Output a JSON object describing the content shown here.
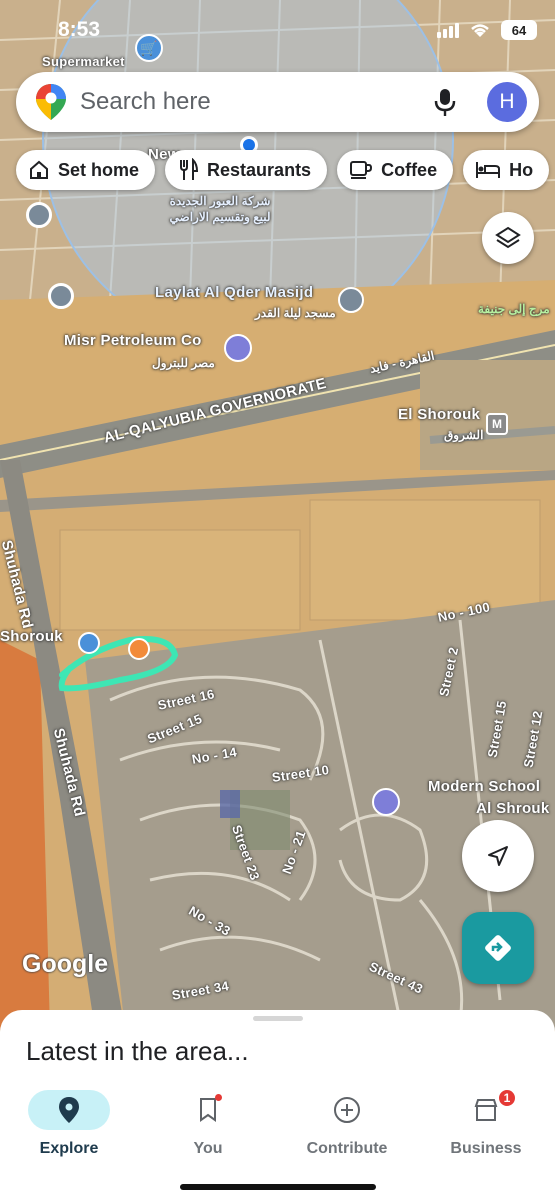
{
  "status_bar": {
    "time": "8:53",
    "battery": "64"
  },
  "search": {
    "placeholder": "Search here",
    "avatar_letter": "H"
  },
  "chips": [
    {
      "label": "Set home",
      "icon": "home-icon"
    },
    {
      "label": "Restaurants",
      "icon": "fork-knife-icon"
    },
    {
      "label": "Coffee",
      "icon": "coffee-icon"
    },
    {
      "label": "Ho",
      "icon": "bed-icon"
    }
  ],
  "map": {
    "labels": {
      "supermarket": "Supermarket",
      "misr_petroleum": "Misr Petroleum Co",
      "misr_petroleum_ar": "مصر للبترول",
      "laylat": "Laylat Al Qder Masijd",
      "laylat_ar": "مسجد ليلة القدر",
      "obour_ar": "شركة العبور الجديدة لبيع وتقسيم الاراضي",
      "governorate": "AL-QALYUBIA GOVERNORATE",
      "cairo_road_ar": "القاهرة - فايد",
      "el_shorouk": "El Shorouk",
      "el_shorouk_ar": "الشروق",
      "shuhada_top": "Shuhada Rd",
      "shuhada_bottom": "Shuhada Rd",
      "shorouk_left": "Shorouk",
      "no_100": "No - 100",
      "street_2": "Street 2",
      "street_15_right": "Street 15",
      "street_12": "Street 12",
      "street_16": "Street 16",
      "street_15": "Street 15",
      "no_14": "No - 14",
      "street_10": "Street 10",
      "street_23": "Street 23",
      "no_21": "No - 21",
      "no_33": "No - 33",
      "street_34": "Street 34",
      "street_43": "Street 43",
      "modern_school": "Modern School",
      "al_shrouk": "Al Shrouk",
      "new_partial": "New",
      "junction_ar": "مرج إلى جنيفة"
    },
    "google": "Google"
  },
  "sheet": {
    "title": "Latest in the area..."
  },
  "nav": [
    {
      "label": "Explore",
      "icon": "location-pin-icon",
      "active": true
    },
    {
      "label": "You",
      "icon": "bookmark-icon",
      "active": false
    },
    {
      "label": "Contribute",
      "icon": "add-circle-icon",
      "active": false
    },
    {
      "label": "Business",
      "icon": "store-icon",
      "active": false,
      "badge": "1"
    }
  ],
  "colors": {
    "accent": "#1a9aa0",
    "active_pill": "#c8f1f7",
    "avatar": "#5b6cdf",
    "badge": "#e53935"
  }
}
